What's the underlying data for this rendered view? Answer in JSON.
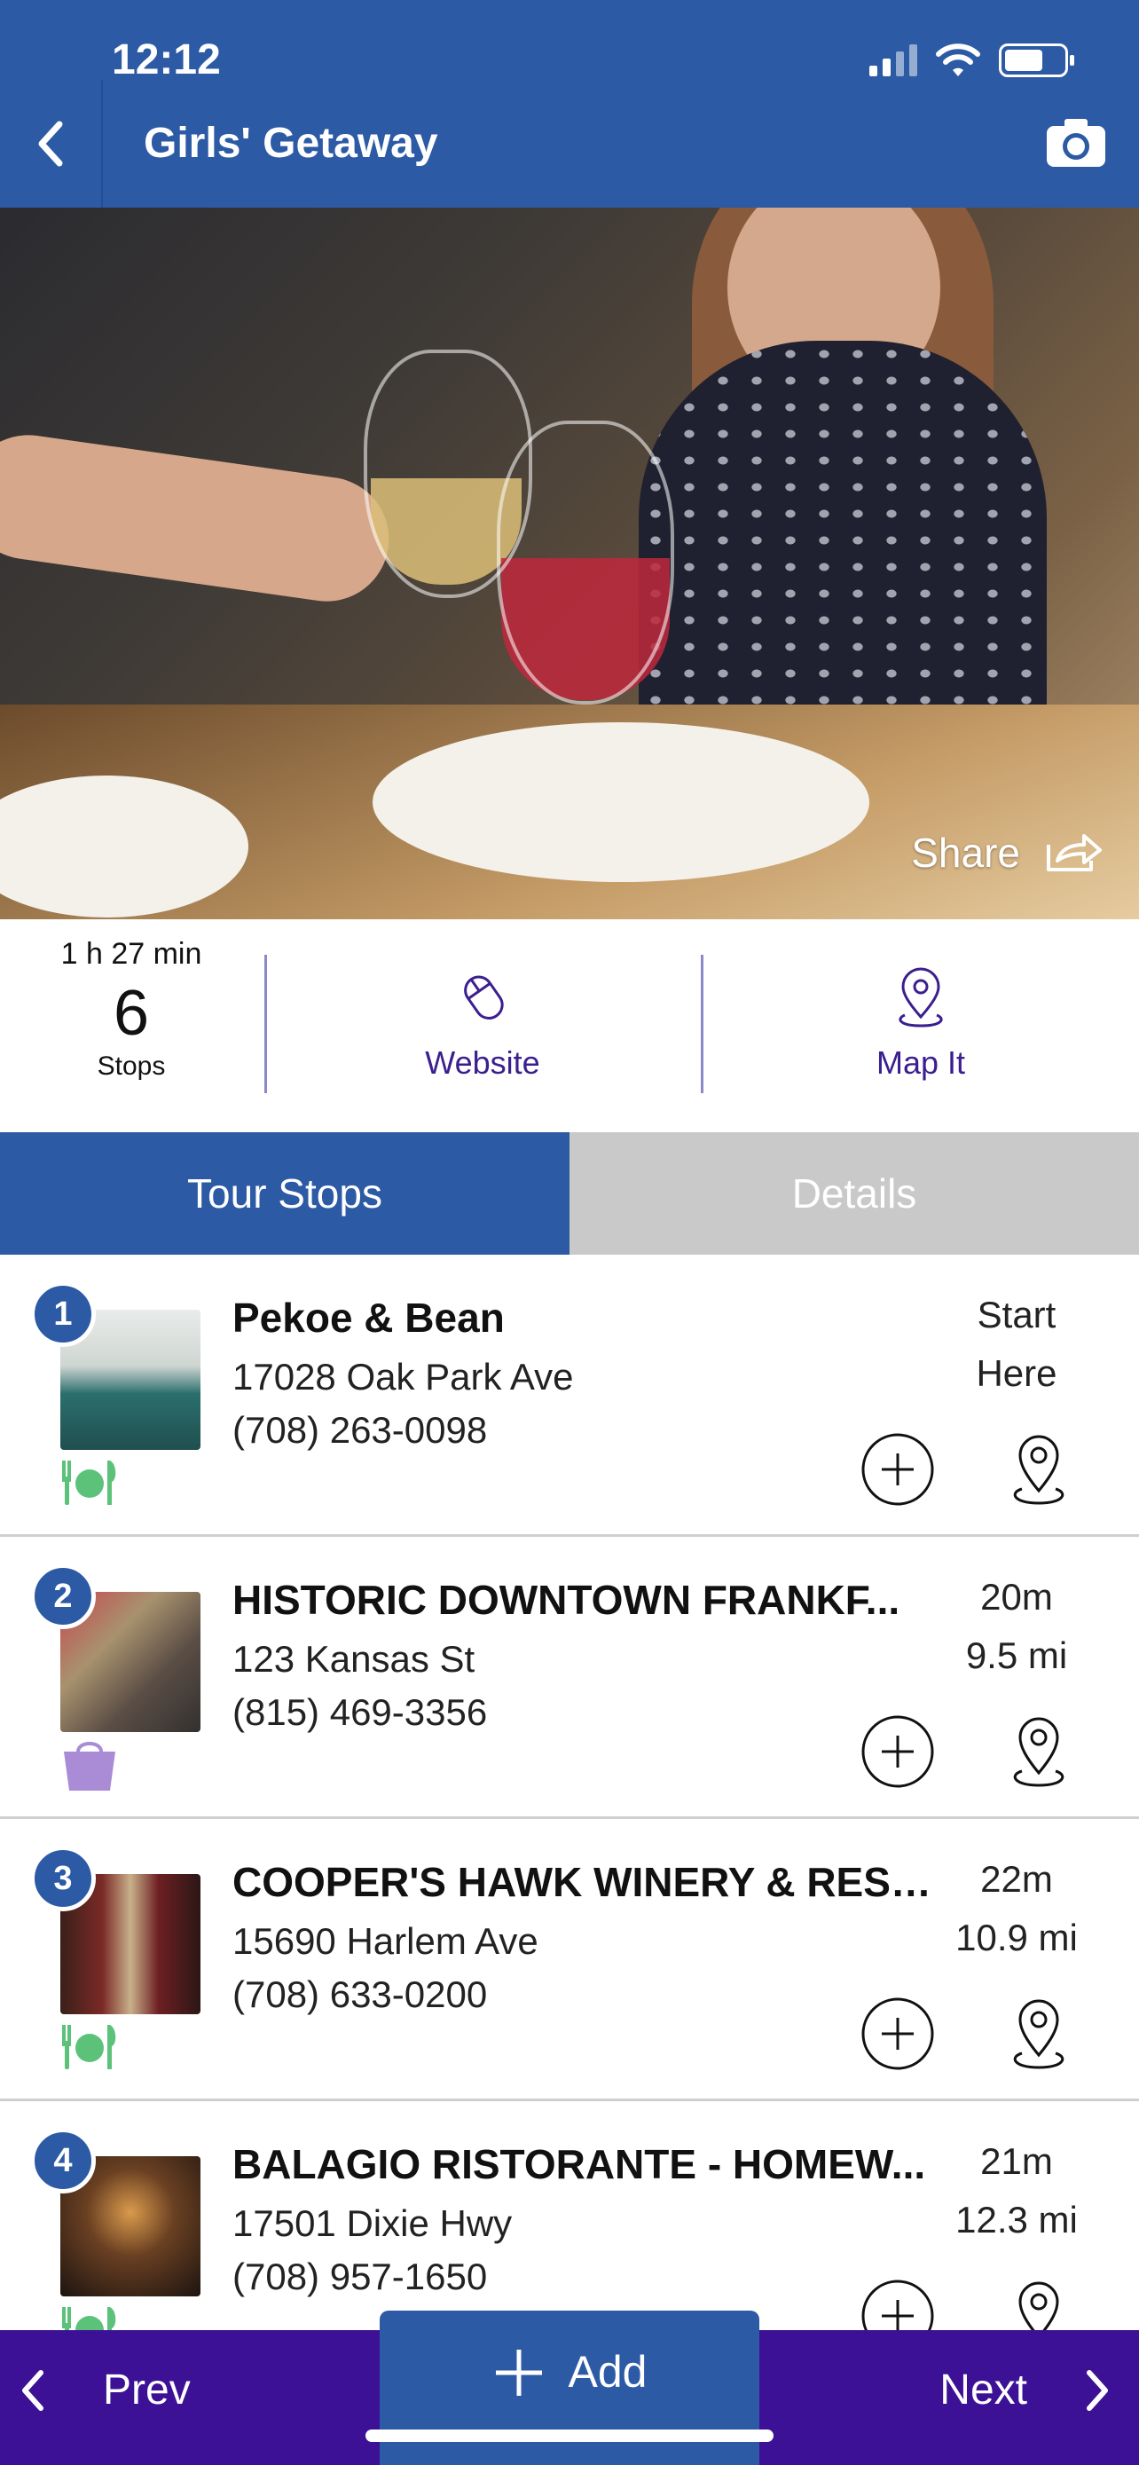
{
  "status_bar": {
    "time": "12:12"
  },
  "header": {
    "title": "Girls' Getaway"
  },
  "hero": {
    "share_label": "Share"
  },
  "summary": {
    "duration": "1 h 27 min",
    "stop_count": "6",
    "stops_label": "Stops",
    "website_label": "Website",
    "map_label": "Map It"
  },
  "tabs": [
    {
      "label": "Tour Stops",
      "active": true
    },
    {
      "label": "Details",
      "active": false
    }
  ],
  "stops": [
    {
      "number": "1",
      "name": "Pekoe & Bean",
      "address": "17028 Oak Park Ave",
      "phone": "(708) 263-0098",
      "meta1": "Start",
      "meta2": "Here",
      "category": "dining-icon"
    },
    {
      "number": "2",
      "name": "HISTORIC DOWNTOWN FRANKF...",
      "address": "123 Kansas St",
      "phone": "(815) 469-3356",
      "meta1": "20m",
      "meta2": "9.5 mi",
      "category": "shopping-bag-icon"
    },
    {
      "number": "3",
      "name": "COOPER'S HAWK WINERY & REST...",
      "address": "15690 Harlem Ave",
      "phone": "(708) 633-0200",
      "meta1": "22m",
      "meta2": "10.9 mi",
      "category": "dining-icon"
    },
    {
      "number": "4",
      "name": "BALAGIO RISTORANTE - HOMEW...",
      "address": "17501 Dixie Hwy",
      "phone": "(708) 957-1650",
      "meta1": "21m",
      "meta2": "12.3 mi",
      "category": "dining-icon"
    }
  ],
  "bottom_nav": {
    "prev_label": "Prev",
    "add_label": "Add",
    "next_label": "Next"
  },
  "colors": {
    "primary_blue": "#2c5aa5",
    "nav_purple": "#3d1195",
    "category_green": "#5cc27a",
    "category_purple": "#a98bd6"
  }
}
